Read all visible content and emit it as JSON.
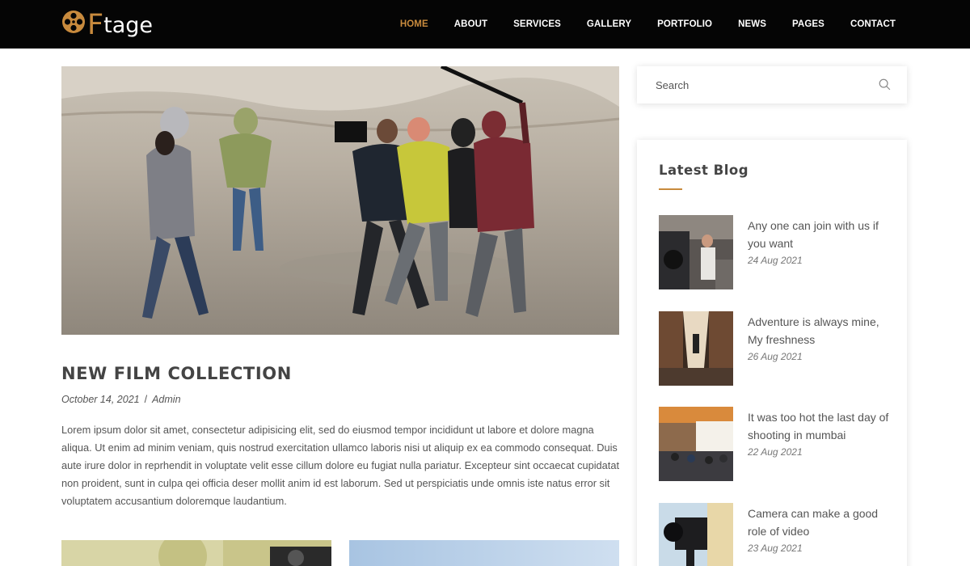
{
  "logo": {
    "first": "F",
    "rest": "tage"
  },
  "nav": [
    {
      "label": "HOME",
      "active": true
    },
    {
      "label": "ABOUT",
      "active": false
    },
    {
      "label": "SERVICES",
      "active": false
    },
    {
      "label": "GALLERY",
      "active": false
    },
    {
      "label": "PORTFOLIO",
      "active": false
    },
    {
      "label": "NEWS",
      "active": false
    },
    {
      "label": "PAGES",
      "active": false
    },
    {
      "label": "CONTACT",
      "active": false
    }
  ],
  "post": {
    "title": "NEW FILM COLLECTION",
    "date": "October 14, 2021",
    "separator": "/",
    "author": "Admin",
    "body": "Lorem ipsum dolor sit amet, consectetur adipisicing elit, sed do eiusmod tempor incididunt ut labore et dolore magna aliqua. Ut enim ad minim veniam, quis nostrud exercitation ullamco laboris nisi ut aliquip ex ea commodo consequat. Duis aute irure dolor in reprhendit in voluptate velit esse cillum dolore eu fugiat nulla pariatur. Excepteur sint occaecat cupidatat non proident, sunt in culpa qei officia deser mollit anim id est laborum. Sed ut perspiciatis unde omnis iste natus error sit voluptatem accusantium doloremque laudantium."
  },
  "search": {
    "placeholder": "Search"
  },
  "sidebar": {
    "latest_heading": "Latest Blog",
    "items": [
      {
        "title": "Any one can join with us if you want",
        "date": "24 Aug 2021"
      },
      {
        "title": "Adventure is always mine, My freshness",
        "date": "26 Aug 2021"
      },
      {
        "title": "It was too hot the last day of shooting in mumbai",
        "date": "22 Aug 2021"
      },
      {
        "title": "Camera can make a good role of video",
        "date": "23 Aug 2021"
      }
    ]
  },
  "colors": {
    "accent": "#c88a3d",
    "header_bg": "#050505"
  }
}
